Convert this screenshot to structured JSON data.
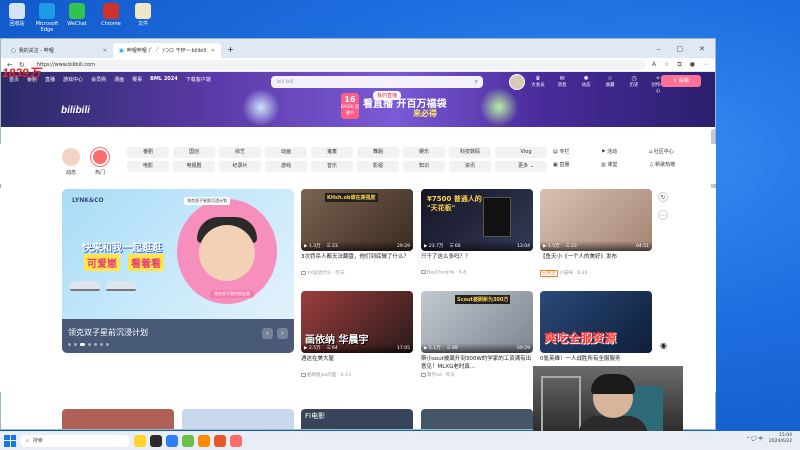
{
  "desktop": {
    "icons": [
      {
        "label": "回收站",
        "color": "#d7e3f3"
      },
      {
        "label": "Microsoft Edge",
        "color": "#1c9be8"
      },
      {
        "label": "WeChat",
        "color": "#32c24d"
      },
      {
        "label": "Chrome",
        "color": "#d0312d"
      },
      {
        "label": "文件",
        "color": "#f0e6c8"
      }
    ]
  },
  "overlay_text": "1839万",
  "browser": {
    "tabs": [
      {
        "title": "我的关注 - 哔哩",
        "active": false
      },
      {
        "title": "哔哩哔哩 (゜-゜)つロ 干杯~-bilibili",
        "active": true
      }
    ],
    "url": "https://www.bilibili.com"
  },
  "bilibili": {
    "topnav": [
      "首页",
      "番剧",
      "直播",
      "游戏中心",
      "会员购",
      "漫画",
      "赛事",
      "BML 2024",
      "下载客户端"
    ],
    "search_placeholder": "bili bili",
    "rightnav": [
      {
        "label": "大会员",
        "icon": "crown"
      },
      {
        "label": "消息",
        "icon": "bell",
        "badge": "99+"
      },
      {
        "label": "动态",
        "icon": "wind",
        "badge": "5"
      },
      {
        "label": "收藏",
        "icon": "star"
      },
      {
        "label": "历史",
        "icon": "clock"
      },
      {
        "label": "创作中心",
        "icon": "bulb"
      }
    ],
    "upload_label": "投稿",
    "logo": "bilibili",
    "promo": {
      "badge_num": "16",
      "badge_text": "BAIDU 直播节",
      "chip": "我的直播",
      "title": "看直播 开百万福袋",
      "sub": "来必得"
    },
    "big_channels": [
      {
        "label": "动态",
        "color": "#f2d4c3"
      },
      {
        "label": "热门",
        "color": "#ff6a6a"
      }
    ],
    "channels": [
      "番剧",
      "国创",
      "综艺",
      "动画",
      "鬼畜",
      "舞蹈",
      "娱乐",
      "科技数码",
      "美食",
      "汽车",
      "体育运动",
      "Vlog",
      "电影",
      "电视剧",
      "纪录片",
      "游戏",
      "音乐",
      "影视",
      "知识",
      "资讯",
      "小剧场",
      "时尚美妆",
      "动物",
      "更多 ⌄"
    ],
    "extra_links": [
      "专栏",
      "活动",
      "社区中心",
      "直播",
      "课堂",
      "新歌热榜"
    ],
    "hero": {
      "brand": "LYNK&CO",
      "line1": "快来和我一起逛逛",
      "tag1": "可爱崽",
      "tag2": "看着看",
      "overlay_tag": "领克双子星前沉浸计划",
      "badge": "领克双子星的朋友圈",
      "title": "领克双子星前沉浸计划"
    },
    "cards": [
      {
        "title": "3次罚杀人都无法翻盘，他们到底做了什么？",
        "views": "1.3万",
        "danmaku": "23",
        "duration": "29:29",
        "up": "XX饭团什么",
        "date": "昨天",
        "thumb": "#6e5a4b",
        "text": "KHsh.ob谁在高强度",
        "text_color": "#ffd34d"
      },
      {
        "title": "只干了这么多吗？？",
        "views": "23.7万",
        "danmaku": "66",
        "duration": "13:04",
        "up": "BayChenJHk",
        "date": "6-8",
        "thumb": "#1b1b2b",
        "text": "¥7500 普通人的 \"天花板\"",
        "text_color": "#ffd34d"
      },
      {
        "title": "【鱼天小《一个人的美好》发布",
        "views": "1.5万",
        "danmaku": "23",
        "duration": "04:51",
        "up": "小猫咪",
        "date": "6-20",
        "thumb": "#c9a99a",
        "text": "",
        "text_color": "#fff",
        "badge": "已关注"
      },
      {
        "title": "遇这在美大屋",
        "views": "2.5万",
        "danmaku": "64",
        "duration": "17:05",
        "up": "酷网络Jan的面",
        "date": "6-13",
        "thumb": "#8a3a3a",
        "text": "画依纳 华晨宇",
        "text_color": "#fff"
      },
      {
        "title": "斯小sout被飙升到300W的学家的工资满有出意见！MLXG老时真...",
        "views": "5.1万",
        "danmaku": "89",
        "duration": "09:29",
        "up": "飘字od",
        "date": "昨天",
        "thumb": "#aab2bb",
        "text": "Scout被刷新为300万",
        "text_color": "#ffd34d"
      },
      {
        "title": "0氪英雄！一人战胜所有全服服务",
        "views": "",
        "danmaku": "",
        "duration": "",
        "up": "",
        "date": "",
        "thumb": "#1e3a66",
        "text": "爽吃全服资源",
        "text_color": "#ff3b3b"
      }
    ],
    "bottom_thumbs": [
      "#b06055",
      "#c8d9ee",
      "#38445a",
      "#445566"
    ]
  },
  "taskbar": {
    "search_placeholder": "搜索",
    "apps": [
      "#ffd22e",
      "#2b2b2b",
      "#2d7ff9",
      "#6ac04a",
      "#ff8a00",
      "#e7562d",
      "#ff6a6a"
    ],
    "time": "15:04",
    "date": "2024/6/22",
    "tray": "^ 💬 中"
  }
}
